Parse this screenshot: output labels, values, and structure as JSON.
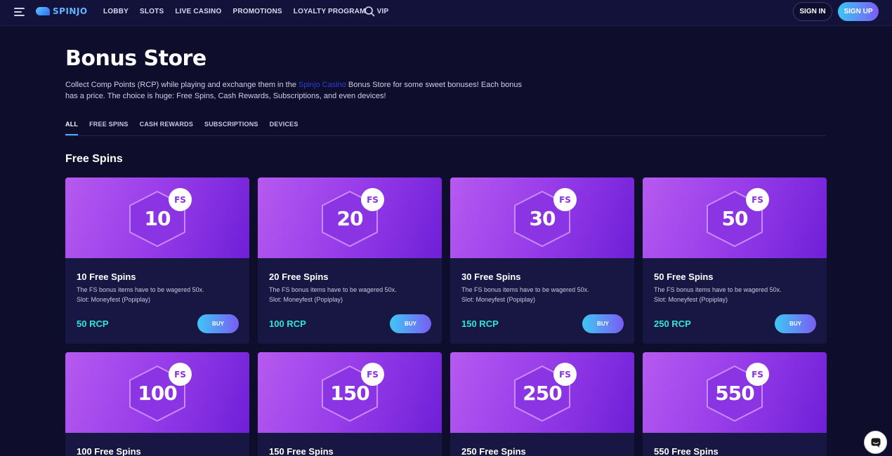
{
  "header": {
    "logo_text": "SPINJO",
    "nav": [
      "LOBBY",
      "SLOTS",
      "LIVE CASINO",
      "PROMOTIONS",
      "LOYALTY PROGRAM",
      "VIP"
    ],
    "sign_in": "SIGN IN",
    "sign_up": "SIGN UP"
  },
  "hero": {
    "title": "Bonus Store",
    "intro_before": "Collect Comp Points (RCP) while playing and exchange them in the ",
    "intro_link": "Spinjo Casino",
    "intro_after": " Bonus Store for some sweet bonuses! Each bonus has a price. The choice is huge: Free Spins, Cash Rewards, Subscriptions, and even devices!"
  },
  "tabs": [
    "ALL",
    "FREE SPINS",
    "CASH REWARDS",
    "SUBSCRIPTIONS",
    "DEVICES"
  ],
  "section_title": "Free Spins",
  "cards": [
    {
      "num": "10",
      "badge": "FS",
      "title": "10 Free Spins",
      "desc1": "The FS bonus items have to be wagered 50x.",
      "desc2": "Slot: Moneyfest (Popiplay)",
      "price": "50 RCP",
      "buy": "BUY"
    },
    {
      "num": "20",
      "badge": "FS",
      "title": "20 Free Spins",
      "desc1": "The FS bonus items have to be wagered 50x.",
      "desc2": "Slot: Moneyfest (Popiplay)",
      "price": "100 RCP",
      "buy": "BUY"
    },
    {
      "num": "30",
      "badge": "FS",
      "title": "30 Free Spins",
      "desc1": "The FS bonus items have to be wagered 50x.",
      "desc2": "Slot: Moneyfest (Popiplay)",
      "price": "150 RCP",
      "buy": "BUY"
    },
    {
      "num": "50",
      "badge": "FS",
      "title": "50 Free Spins",
      "desc1": "The FS bonus items have to be wagered 50x.",
      "desc2": "Slot: Moneyfest (Popiplay)",
      "price": "250 RCP",
      "buy": "BUY"
    },
    {
      "num": "100",
      "badge": "FS",
      "title": "100 Free Spins"
    },
    {
      "num": "150",
      "badge": "FS",
      "title": "150 Free Spins"
    },
    {
      "num": "250",
      "badge": "FS",
      "title": "250 Free Spins"
    },
    {
      "num": "550",
      "badge": "FS",
      "title": "550 Free Spins"
    }
  ],
  "icons": {
    "menu": "hamburger-icon",
    "search": "search-icon",
    "chat": "chat-icon"
  },
  "colors": {
    "background": "#0e0d2b",
    "card": "#181743",
    "price": "#2ee6d8",
    "accent_start": "#3fc7f4",
    "accent_end": "#7a5cf3",
    "art": "#9a3fea"
  }
}
